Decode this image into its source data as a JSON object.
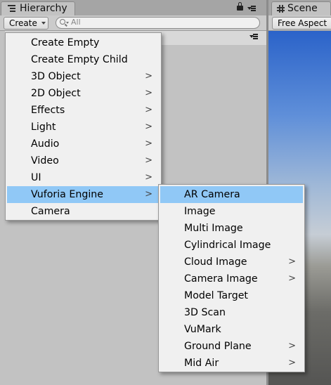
{
  "hierarchy": {
    "tab_label": "Hierarchy",
    "create_label": "Create",
    "search_placeholder": "All"
  },
  "scene": {
    "tab_label": "Scene",
    "aspect_label": "Free Aspect"
  },
  "create_menu": {
    "items": [
      {
        "label": "Create Empty",
        "submenu": false,
        "highlighted": false
      },
      {
        "label": "Create Empty Child",
        "submenu": false,
        "highlighted": false
      },
      {
        "label": "3D Object",
        "submenu": true,
        "highlighted": false
      },
      {
        "label": "2D Object",
        "submenu": true,
        "highlighted": false
      },
      {
        "label": "Effects",
        "submenu": true,
        "highlighted": false
      },
      {
        "label": "Light",
        "submenu": true,
        "highlighted": false
      },
      {
        "label": "Audio",
        "submenu": true,
        "highlighted": false
      },
      {
        "label": "Video",
        "submenu": true,
        "highlighted": false
      },
      {
        "label": "UI",
        "submenu": true,
        "highlighted": false
      },
      {
        "label": "Vuforia Engine",
        "submenu": true,
        "highlighted": true
      },
      {
        "label": "Camera",
        "submenu": false,
        "highlighted": false
      }
    ]
  },
  "vuforia_menu": {
    "items": [
      {
        "label": "AR Camera",
        "submenu": false,
        "highlighted": true
      },
      {
        "label": "Image",
        "submenu": false,
        "highlighted": false
      },
      {
        "label": "Multi Image",
        "submenu": false,
        "highlighted": false
      },
      {
        "label": "Cylindrical Image",
        "submenu": false,
        "highlighted": false
      },
      {
        "label": "Cloud Image",
        "submenu": true,
        "highlighted": false
      },
      {
        "label": "Camera Image",
        "submenu": true,
        "highlighted": false
      },
      {
        "label": "Model Target",
        "submenu": false,
        "highlighted": false
      },
      {
        "label": "3D Scan",
        "submenu": false,
        "highlighted": false
      },
      {
        "label": "VuMark",
        "submenu": false,
        "highlighted": false
      },
      {
        "label": "Ground Plane",
        "submenu": true,
        "highlighted": false
      },
      {
        "label": "Mid Air",
        "submenu": true,
        "highlighted": false
      }
    ]
  },
  "icons": {
    "hierarchy_tab": "hierarchy-list-icon",
    "lock": "lock-icon",
    "panel_menu": "panel-menu-icon",
    "search": "search-icon",
    "scene_tab": "scene-grid-icon",
    "submenu": "chevron-right-icon"
  },
  "colors": {
    "highlight": "#90c8f6",
    "menu_bg": "#f0f0f0",
    "panel_bg": "#c2c2c2",
    "sky": "#2b63c9"
  }
}
